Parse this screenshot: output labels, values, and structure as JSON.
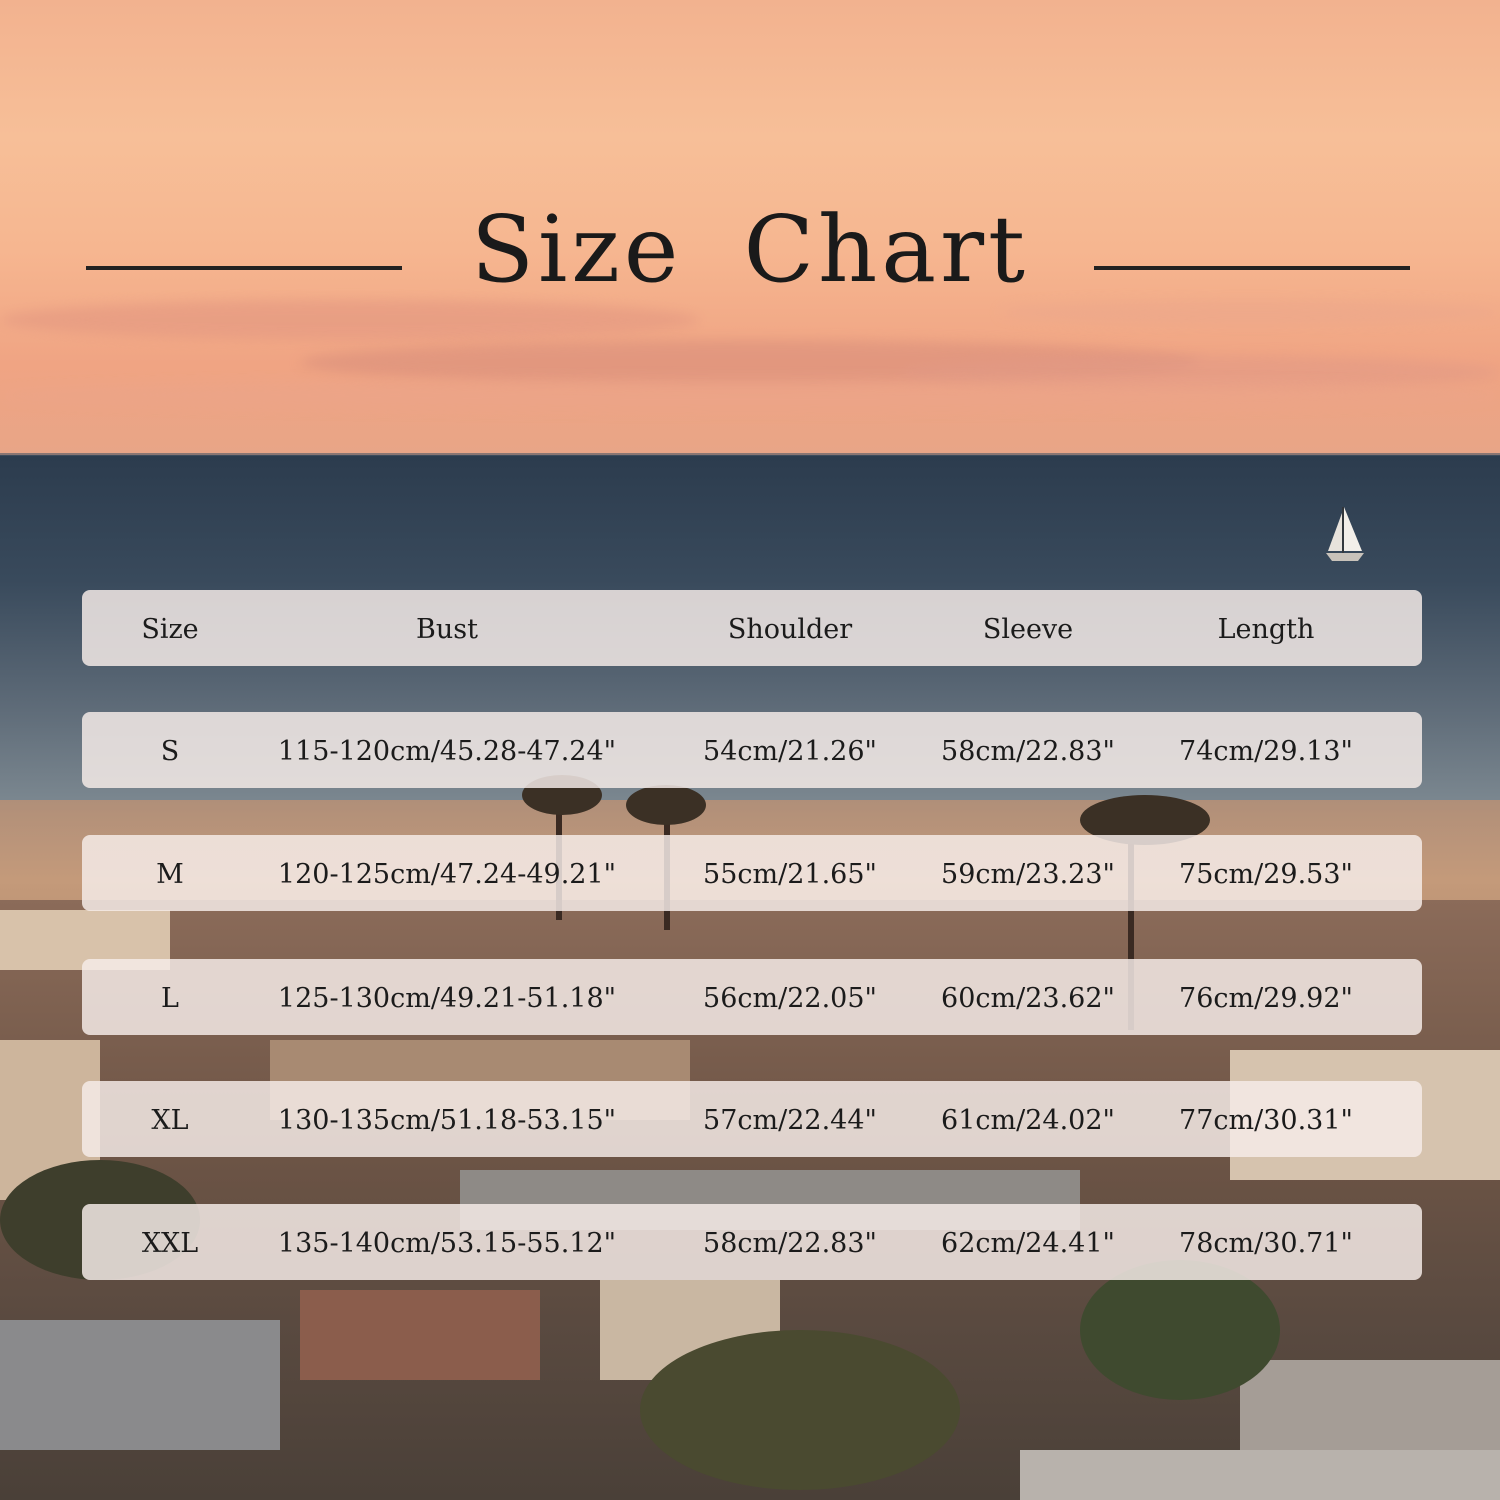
{
  "title": "Size Chart",
  "table": {
    "headers": [
      "Size",
      "Bust",
      "Shoulder",
      "Sleeve",
      "Length"
    ],
    "rows": [
      [
        "S",
        "115-120cm/45.28-47.24\"",
        "54cm/21.26\"",
        "58cm/22.83\"",
        "74cm/29.13\""
      ],
      [
        "M",
        "120-125cm/47.24-49.21\"",
        "55cm/21.65\"",
        "59cm/23.23\"",
        "75cm/29.53\""
      ],
      [
        "L",
        "125-130cm/49.21-51.18\"",
        "56cm/22.05\"",
        "60cm/23.62\"",
        "76cm/29.92\""
      ],
      [
        "XL",
        "130-135cm/51.18-53.15\"",
        "57cm/22.44\"",
        "61cm/24.02\"",
        "77cm/30.31\""
      ],
      [
        "XXL",
        "135-140cm/53.15-55.12\"",
        "58cm/22.83\"",
        "62cm/24.41\"",
        "78cm/30.71\""
      ]
    ]
  },
  "colors": {
    "text": "#1b1b1b",
    "row_background": "#f6ece8",
    "sky": "#f6b690",
    "ocean": "#394a5c"
  }
}
